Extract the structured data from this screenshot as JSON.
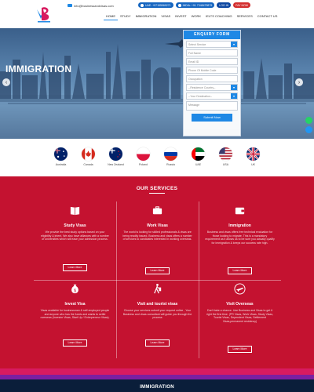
{
  "header": {
    "email": "info@businessandvisas.com",
    "uae_phone": "UAE: +97155969271",
    "india_phone": "INDIA: +91 7348475875",
    "login": "LOG IN",
    "pay_now": "PAY NOW"
  },
  "nav": [
    "HOME",
    "STUDY",
    "IMMIGRATION",
    "VISAS",
    "INVEST",
    "WORK",
    "IELTS COACHING",
    "SERVICES",
    "CONTACT US"
  ],
  "hero": {
    "title": "IMMIGRATION"
  },
  "enquiry": {
    "heading": "ENQUIRY FORM",
    "select_service": "Select Service",
    "full_name": "Full Name",
    "email": "Email ID",
    "phone": "Phone Of Mobile Code",
    "occupation": "Occupation",
    "residence": "--Residence Country--",
    "destination": "--Your Destination--",
    "message": "Message",
    "submit": "Submit Now"
  },
  "flags": [
    {
      "label": "Australia",
      "name": "australia"
    },
    {
      "label": "Canada",
      "name": "canada"
    },
    {
      "label": "New Zealand",
      "name": "new-zealand"
    },
    {
      "label": "Poland",
      "name": "poland"
    },
    {
      "label": "Russia",
      "name": "russia"
    },
    {
      "label": "UAE",
      "name": "uae"
    },
    {
      "label": "USA",
      "name": "usa"
    },
    {
      "label": "UK",
      "name": "uk"
    }
  ],
  "services": {
    "title": "OUR SERVICES",
    "cards": [
      {
        "title": "Study Visas",
        "text": "We provide the best study options based on your eligibility & intent. We also have alliances with a number of universities which will ease your admission process.",
        "button": "Learn More",
        "icon": "book-icon"
      },
      {
        "title": "Work Visas",
        "text": "The world is looking for skilled professionals & visas are being readily issued. Business and visas offers a number of services to candidates interested in working overseas.",
        "button": "Learn More",
        "icon": "briefcase-icon"
      },
      {
        "title": "Immigration",
        "text": "Business and visas offers free technical evaluation for those looking to migrate. This is a mandatory requirement as it allows us to be sure you actually qualify for immigration & keeps our success rate high.",
        "button": "Learn More",
        "icon": "wallet-icon"
      },
      {
        "title": "Invest Visa",
        "text": "Visas available for businessman & self-employed people and anyone who has the funds and wants to settle overseas (Investor Visas, Start Up / Entrepreneur Visas).",
        "button": "Learn More",
        "icon": "money-bag-icon"
      },
      {
        "title": "Visit and tourist visas",
        "text": "Choose your services submit your request online , Your Business and visas consultant will guide you through the process",
        "button": "Learn More",
        "icon": "traveler-icon"
      },
      {
        "title": "Visit Overseas",
        "text": "Don't take a chance. Use Business and Visas to get it right the first time. (PR Visas, Work Visas, Study Visas, Tourist Visas, Dependent Visas, Settlement Visas,permanent residency)",
        "button": "Learn More",
        "icon": "plane-icon"
      }
    ]
  },
  "bottom": {
    "title": "IMMIGRATION"
  }
}
